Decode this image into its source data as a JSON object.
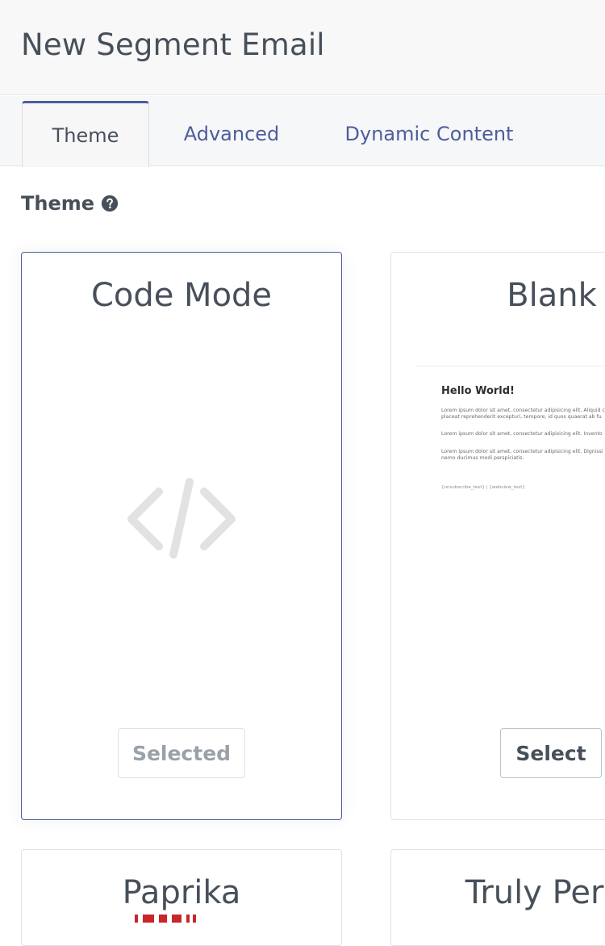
{
  "page": {
    "title": "New Segment Email"
  },
  "tabs": [
    {
      "label": "Theme",
      "active": true
    },
    {
      "label": "Advanced",
      "active": false
    },
    {
      "label": "Dynamic Content",
      "active": false
    }
  ],
  "theme_section": {
    "label": "Theme",
    "help_icon": "question-circle-icon"
  },
  "cards": [
    {
      "title": "Code Mode",
      "button_label": "Selected",
      "selected": true,
      "icon": "code-icon"
    },
    {
      "title": "Blank",
      "button_label": "Select",
      "selected": false,
      "preview": {
        "heading": "Hello World!",
        "para1_line1": "Lorem ipsum dolor sit amet, consectetur adipisicing elit. Aliquid c",
        "para1_line2": "placeat reprehenderit excepturi, tempore, id quos quaerat ab fu",
        "para2_line1": "Lorem ipsum dolor sit amet, consectetur adipisicing elit. Invento",
        "para3_line1": "Lorem ipsum dolor sit amet, consectetur adipisicing elit. Dignissi",
        "para3_line2": "nemo ducimus modi perspiciatis.",
        "footer": "{unsubscribe_text} | {webview_text}"
      }
    },
    {
      "title": "Paprika",
      "button_label": "",
      "selected": false
    },
    {
      "title": "Truly Persc",
      "button_label": "",
      "selected": false
    }
  ],
  "colors": {
    "accent": "#4e5d9d",
    "text": "#47505a",
    "muted": "#9ba1a8",
    "paprika_red": "#c8262b"
  }
}
